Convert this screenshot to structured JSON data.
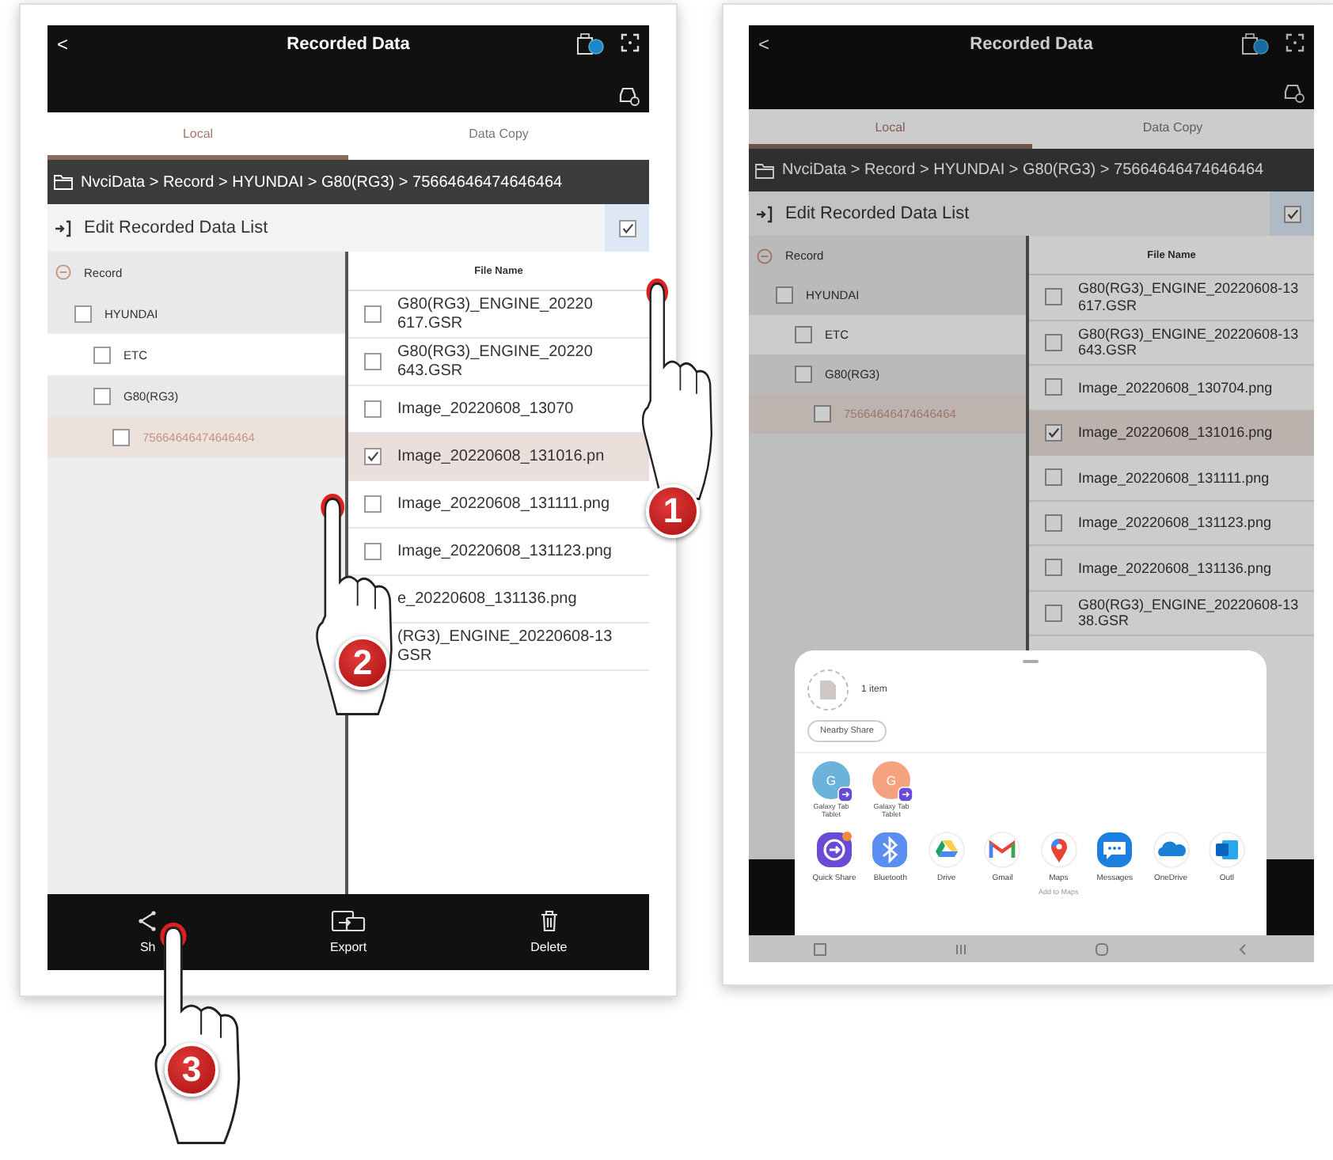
{
  "screens": [
    {
      "back": "<",
      "title": "Recorded Data",
      "tabs": [
        {
          "label": "Local",
          "selected": true
        },
        {
          "label": "Data Copy",
          "selected": false
        }
      ],
      "breadcrumb": "NvciData > Record > HYUNDAI > G80(RG3) > 75664646474646464",
      "toolbar": {
        "label": "Edit Recorded Data List",
        "checked": true
      },
      "tree": {
        "label": "Record",
        "expanded": true,
        "selected": false,
        "children": [
          {
            "label": "HYUNDAI",
            "checked": false,
            "selected": false,
            "children": [
              {
                "label": "ETC",
                "checked": false,
                "selected": false
              },
              {
                "label": "G80(RG3)",
                "checked": false,
                "selected": false,
                "children": [
                  {
                    "label": "75664646474646464",
                    "checked": false,
                    "selected": true
                  }
                ]
              }
            ]
          }
        ]
      },
      "files": {
        "header": "File Name",
        "rows": [
          {
            "name": "G80(RG3)_ENGINE_20220\n617.GSR",
            "checked": false,
            "selected": false
          },
          {
            "name": "G80(RG3)_ENGINE_20220\n643.GSR",
            "checked": false,
            "selected": false
          },
          {
            "name": "Image_20220608_13070",
            "checked": false,
            "selected": false
          },
          {
            "name": "Image_20220608_131016.pn",
            "checked": true,
            "selected": true
          },
          {
            "name": "Image_20220608_131111.png",
            "checked": false,
            "selected": false
          },
          {
            "name": "Image_20220608_131123.png",
            "checked": false,
            "selected": false
          },
          {
            "name": "e_20220608_131136.png",
            "selected": false
          },
          {
            "name": "(RG3)_ENGINE_20220608-13\nGSR",
            "selected": false
          }
        ]
      },
      "actions": [
        {
          "kind": "share",
          "label": "Sh"
        },
        {
          "kind": "export",
          "label": "Export"
        },
        {
          "kind": "delete",
          "label": "Delete"
        }
      ],
      "callouts": [
        {
          "number": "1"
        },
        {
          "number": "2"
        },
        {
          "number": "3"
        }
      ]
    },
    {
      "back": "<",
      "title": "Recorded Data",
      "dimmed": true,
      "nav_bar": true,
      "tabs": [
        {
          "label": "Local",
          "selected": true
        },
        {
          "label": "Data Copy",
          "selected": false
        }
      ],
      "breadcrumb": "NvciData > Record > HYUNDAI > G80(RG3) > 75664646474646464",
      "toolbar": {
        "label": "Edit Recorded Data List",
        "checked": true
      },
      "tree": {
        "label": "Record",
        "expanded": true,
        "selected": false,
        "children": [
          {
            "label": "HYUNDAI",
            "checked": false,
            "selected": false,
            "children": [
              {
                "label": "ETC",
                "checked": false,
                "selected": false
              },
              {
                "label": "G80(RG3)",
                "checked": false,
                "selected": false,
                "children": [
                  {
                    "label": "75664646474646464",
                    "checked": false,
                    "selected": true
                  }
                ]
              }
            ]
          }
        ]
      },
      "files": {
        "header": "File Name",
        "rows": [
          {
            "name": "G80(RG3)_ENGINE_20220608-13\n617.GSR",
            "checked": false,
            "selected": false
          },
          {
            "name": "G80(RG3)_ENGINE_20220608-13\n643.GSR",
            "checked": false,
            "selected": false
          },
          {
            "name": "Image_20220608_130704.png",
            "checked": false,
            "selected": false
          },
          {
            "name": "Image_20220608_131016.png",
            "checked": true,
            "selected": true
          },
          {
            "name": "Image_20220608_131111.png",
            "checked": false,
            "selected": false
          },
          {
            "name": "Image_20220608_131123.png",
            "checked": false,
            "selected": false
          },
          {
            "name": "Image_20220608_131136.png",
            "checked": false,
            "selected": false
          },
          {
            "name": "G80(RG3)_ENGINE_20220608-13\n38.GSR",
            "checked": false,
            "selected": false
          }
        ]
      },
      "share_sheet": {
        "summary": "1 item",
        "nearby": "Nearby Share",
        "devices": [
          {
            "initial": "G",
            "name": "Galaxy Tab",
            "sub": "Tablet",
            "color": "#6bb3d9"
          },
          {
            "initial": "G",
            "name": "Galaxy Tab",
            "sub": "Tablet",
            "color": "#f5a27f"
          }
        ],
        "apps": [
          {
            "kind": "quick_share",
            "label": "Quick Share"
          },
          {
            "kind": "bluetooth",
            "label": "Bluetooth"
          },
          {
            "kind": "drive",
            "label": "Drive"
          },
          {
            "kind": "gmail",
            "label": "Gmail"
          },
          {
            "kind": "maps",
            "label": "Maps",
            "sublabel": "Add to Maps"
          },
          {
            "kind": "messages",
            "label": "Messages"
          },
          {
            "kind": "onedrive",
            "label": "OneDrive"
          },
          {
            "kind": "outlook",
            "label": "Outl"
          }
        ]
      }
    }
  ]
}
